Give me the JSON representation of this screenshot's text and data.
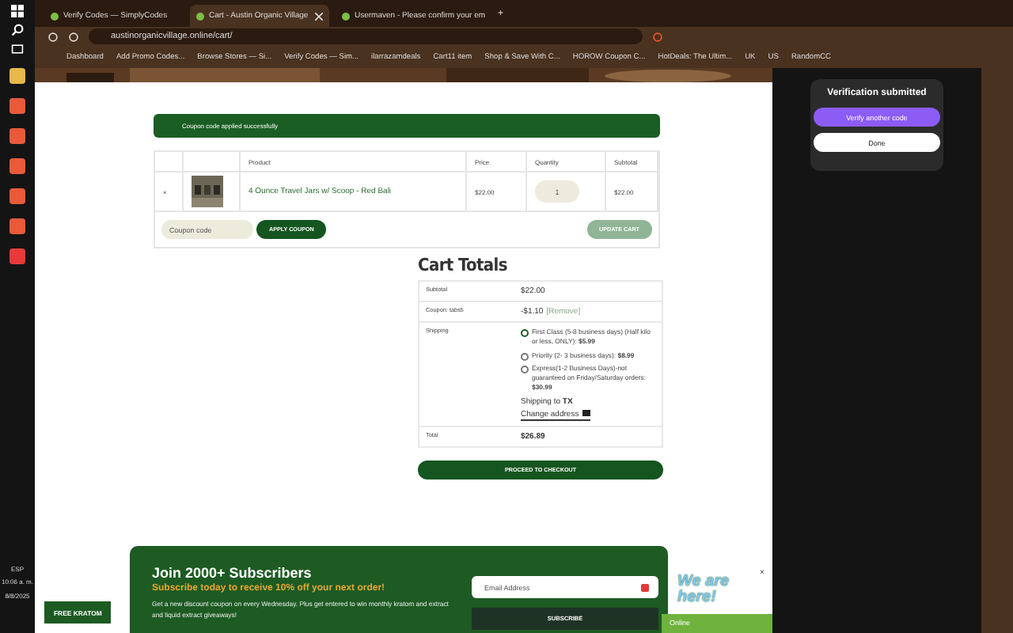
{
  "taskbar": {
    "apps": [
      {
        "color": "#e8b84a"
      },
      {
        "color": "#e85a3a"
      },
      {
        "color": "#e85a3a"
      },
      {
        "color": "#e85a3a"
      },
      {
        "color": "#e85a3a"
      },
      {
        "color": "#e85a3a"
      },
      {
        "color": "#e83a3a"
      }
    ],
    "language": "ESP",
    "time": "10:06 a. m.",
    "date": "8/8/2025"
  },
  "tabs": [
    {
      "title": "Verify Codes — SimplyCodes",
      "selected": false,
      "close": false
    },
    {
      "title": "Cart - Austin Organic Village",
      "selected": true,
      "close": true
    },
    {
      "title": "Usermaven - Please confirm your em",
      "selected": false,
      "close": false
    }
  ],
  "new_tab": "+",
  "url": "austinorganicvillage.online/cart/",
  "bookmarks": [
    "Dashboard",
    "Add Promo Codes...",
    "Browse Stores — Si...",
    "Verify Codes — Sim...",
    "ilarrazamdeals",
    "Cart11 item",
    "Shop & Save With C...",
    "HOROW Coupon C...",
    "HotDeals: The Ultim...",
    "UK",
    "US",
    "RandomCC"
  ],
  "notice": "Coupon code applied successfully",
  "cart": {
    "columns": [
      "",
      "",
      "Product",
      "Price",
      "Quantity",
      "Subtotal"
    ],
    "rows": [
      {
        "remove": "×",
        "product": "4 Ounce Travel Jars w/ Scoop - Red Bali",
        "price": "$22.00",
        "quantity": "1",
        "subtotal": "$22.00"
      }
    ],
    "coupon_placeholder": "Coupon code",
    "apply": "APPLY COUPON",
    "update": "UPDATE CART"
  },
  "totals": {
    "title": "Cart Totals",
    "subtotal_label": "Subtotal",
    "subtotal": "$22.00",
    "coupon_label": "Coupon: tabs5",
    "coupon_value": "-$1.10",
    "remove": "[Remove]",
    "shipping_label": "Shipping",
    "options": [
      {
        "label": "First Class (5-8 business days) (Half kilo or less, ONLY):",
        "price": "$5.99",
        "selected": true
      },
      {
        "label": "Priority (2- 3 business days):",
        "price": "$8.99",
        "selected": false
      },
      {
        "label": "Express(1-2 Business Days)-not guaranteed on Friday/Saturday orders:",
        "price": "$30.99",
        "selected": false
      }
    ],
    "shipping_to": "Shipping to",
    "state": "TX",
    "change": "Change address",
    "total_label": "Total",
    "total": "$26.89",
    "checkout": "PROCEED TO CHECKOUT"
  },
  "newsletter": {
    "title": "Join 2000+ Subscribers",
    "subtitle": "Subscribe today to receive 10% off your next order!",
    "text": "Get a new discount coupon on every Wednesday. Plus get entered to win monthly kratom and extract and liquid extract giveaways!",
    "placeholder": "Email Address",
    "button": "SUBSCRIBE"
  },
  "free_button": "FREE KRATOM",
  "chat": {
    "badge": "We are here!",
    "close": "×",
    "status": "Online"
  },
  "panel": {
    "title": "Verification submitted",
    "primary": "Verify another code",
    "secondary": "Done"
  }
}
